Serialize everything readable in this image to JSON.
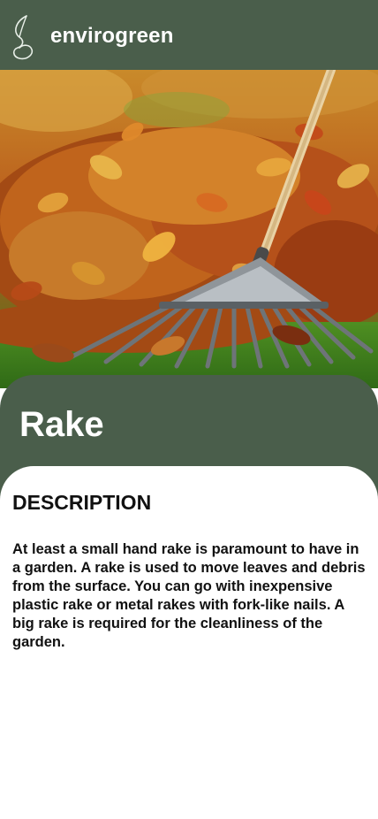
{
  "header": {
    "brand": "envirogreen",
    "logo_icon": "leaf-logo-icon",
    "background": "#4a5e4b"
  },
  "hero": {
    "image": "rake-on-autumn-leaves-photo"
  },
  "item": {
    "title": "Rake"
  },
  "details": {
    "heading": "DESCRIPTION",
    "text": "At least a small hand rake is paramount to have in a garden. A rake is used to move leaves and debris from the surface. You can go with inexpensive plastic rake or metal rakes with fork-like nails. A big rake is required for the cleanliness of the garden."
  }
}
